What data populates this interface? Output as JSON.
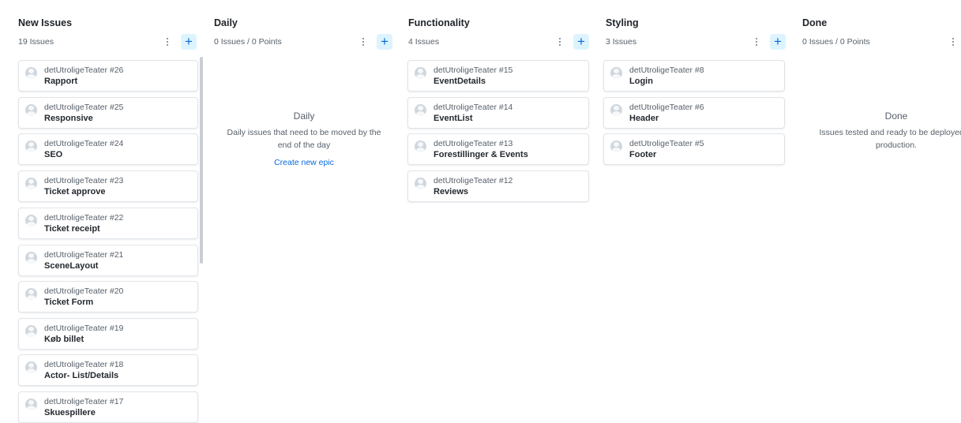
{
  "columns": [
    {
      "title": "New Issues",
      "subtitle": "19 Issues"
    },
    {
      "title": "Daily",
      "subtitle": "0 Issues / 0 Points",
      "empty": {
        "title": "Daily",
        "description": "Daily issues that need to be moved by the end of the day",
        "link": "Create new epic"
      }
    },
    {
      "title": "Functionality",
      "subtitle": "4 Issues"
    },
    {
      "title": "Styling",
      "subtitle": "3 Issues"
    },
    {
      "title": "Done",
      "subtitle": "0 Issues / 0 Points",
      "empty": {
        "title": "Done",
        "description": "Issues tested and ready to be deployed to production."
      }
    }
  ],
  "cards": {
    "new_issues": [
      {
        "repo": "detUtroligeTeater #26",
        "title": "Rapport"
      },
      {
        "repo": "detUtroligeTeater #25",
        "title": "Responsive"
      },
      {
        "repo": "detUtroligeTeater #24",
        "title": "SEO"
      },
      {
        "repo": "detUtroligeTeater #23",
        "title": "Ticket approve"
      },
      {
        "repo": "detUtroligeTeater #22",
        "title": "Ticket receipt"
      },
      {
        "repo": "detUtroligeTeater #21",
        "title": "SceneLayout"
      },
      {
        "repo": "detUtroligeTeater #20",
        "title": "Ticket Form"
      },
      {
        "repo": "detUtroligeTeater #19",
        "title": "Køb billet"
      },
      {
        "repo": "detUtroligeTeater #18",
        "title": "Actor- List/Details"
      },
      {
        "repo": "detUtroligeTeater #17",
        "title": "Skuespillere"
      }
    ],
    "functionality": [
      {
        "repo": "detUtroligeTeater #15",
        "title": "EventDetails"
      },
      {
        "repo": "detUtroligeTeater #14",
        "title": "EventList"
      },
      {
        "repo": "detUtroligeTeater #13",
        "title": "Forestillinger & Events"
      },
      {
        "repo": "detUtroligeTeater #12",
        "title": "Reviews"
      }
    ],
    "styling": [
      {
        "repo": "detUtroligeTeater #8",
        "title": "Login"
      },
      {
        "repo": "detUtroligeTeater #6",
        "title": "Header"
      },
      {
        "repo": "detUtroligeTeater #5",
        "title": "Footer"
      }
    ]
  },
  "icons": {
    "menu": "vertical-ellipsis-icon",
    "add": "plus-icon",
    "avatar": "user-avatar-icon"
  },
  "colors": {
    "accent": "#0969da",
    "add_button_bg": "#ddf4ff"
  }
}
